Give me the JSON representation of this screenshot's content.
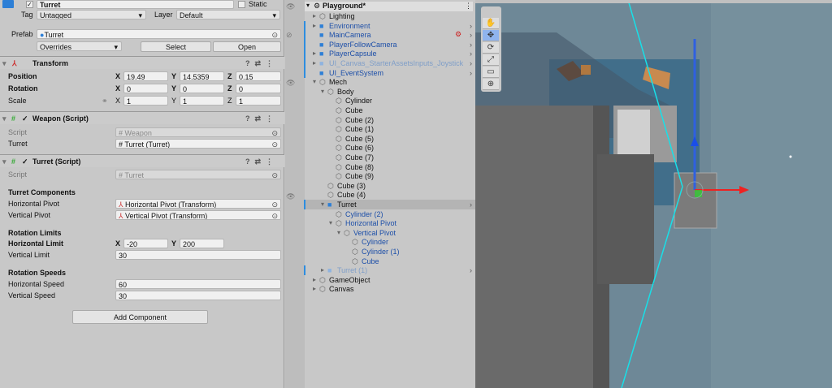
{
  "inspector": {
    "object_name": "Turret",
    "static_label": "Static",
    "tag_label": "Tag",
    "tag_value": "Untagged",
    "layer_label": "Layer",
    "layer_value": "Default",
    "prefab_label": "Prefab",
    "prefab_value": "Turret",
    "overrides": "Overrides",
    "select": "Select",
    "open": "Open",
    "transform": {
      "title": "Transform",
      "position_label": "Position",
      "rotation_label": "Rotation",
      "scale_label": "Scale",
      "position": {
        "x": "19.49",
        "y": "14.5359",
        "z": "0.15"
      },
      "rotation": {
        "x": "0",
        "y": "0",
        "z": "0"
      },
      "scale": {
        "x": "1",
        "y": "1",
        "z": "1"
      }
    },
    "weapon": {
      "title": "Weapon (Script)",
      "script_label": "Script",
      "script_value": "Weapon",
      "turret_label": "Turret",
      "turret_value": "Turret (Turret)"
    },
    "turret": {
      "title": "Turret (Script)",
      "script_label": "Script",
      "script_value": "Turret",
      "components_header": "Turret Components",
      "hpivot_label": "Horizontal Pivot",
      "hpivot_value": "Horizontal Pivot (Transform)",
      "vpivot_label": "Vertical Pivot",
      "vpivot_value": "Vertical Pivot (Transform)",
      "limits_header": "Rotation Limits",
      "hlimit_label": "Horizontal Limit",
      "hlimit_x": "-20",
      "hlimit_y": "200",
      "vlimit_label": "Vertical Limit",
      "vlimit_value": "30",
      "speeds_header": "Rotation Speeds",
      "hspeed_label": "Horizontal Speed",
      "hspeed_value": "60",
      "vspeed_label": "Vertical Speed",
      "vspeed_value": "30"
    },
    "add_component": "Add Component"
  },
  "hierarchy": {
    "scene": "Playground*",
    "items": [
      {
        "label": "Lighting",
        "depth": 0,
        "arrow": "right",
        "style": "normal",
        "prefab": false
      },
      {
        "label": "Environment",
        "depth": 0,
        "arrow": "right",
        "style": "blue",
        "prefab": true
      },
      {
        "label": "MainCamera",
        "depth": 0,
        "arrow": "",
        "style": "blue",
        "prefab": true
      },
      {
        "label": "PlayerFollowCamera",
        "depth": 0,
        "arrow": "",
        "style": "blue",
        "prefab": true
      },
      {
        "label": "PlayerCapsule",
        "depth": 0,
        "arrow": "right",
        "style": "blue",
        "prefab": true
      },
      {
        "label": "UI_Canvas_StarterAssetsInputs_Joystick",
        "depth": 0,
        "arrow": "right",
        "style": "faded",
        "prefab": true
      },
      {
        "label": "UI_EventSystem",
        "depth": 0,
        "arrow": "",
        "style": "blue",
        "prefab": true
      },
      {
        "label": "Mech",
        "depth": 0,
        "arrow": "down",
        "style": "normal",
        "prefab": false
      },
      {
        "label": "Body",
        "depth": 1,
        "arrow": "down",
        "style": "normal",
        "prefab": false
      },
      {
        "label": "Cylinder",
        "depth": 2,
        "arrow": "",
        "style": "normal",
        "prefab": false
      },
      {
        "label": "Cube",
        "depth": 2,
        "arrow": "",
        "style": "normal",
        "prefab": false
      },
      {
        "label": "Cube (2)",
        "depth": 2,
        "arrow": "",
        "style": "normal",
        "prefab": false
      },
      {
        "label": "Cube (1)",
        "depth": 2,
        "arrow": "",
        "style": "normal",
        "prefab": false
      },
      {
        "label": "Cube (5)",
        "depth": 2,
        "arrow": "",
        "style": "normal",
        "prefab": false
      },
      {
        "label": "Cube (6)",
        "depth": 2,
        "arrow": "",
        "style": "normal",
        "prefab": false
      },
      {
        "label": "Cube (7)",
        "depth": 2,
        "arrow": "",
        "style": "normal",
        "prefab": false
      },
      {
        "label": "Cube (8)",
        "depth": 2,
        "arrow": "",
        "style": "normal",
        "prefab": false
      },
      {
        "label": "Cube (9)",
        "depth": 2,
        "arrow": "",
        "style": "normal",
        "prefab": false
      },
      {
        "label": "Cube (3)",
        "depth": 1,
        "arrow": "",
        "style": "normal",
        "prefab": false
      },
      {
        "label": "Cube (4)",
        "depth": 1,
        "arrow": "",
        "style": "normal",
        "prefab": false
      },
      {
        "label": "Turret",
        "depth": 1,
        "arrow": "down",
        "style": "selected",
        "prefab": true
      },
      {
        "label": "Cylinder (2)",
        "depth": 2,
        "arrow": "",
        "style": "blue",
        "prefab": false
      },
      {
        "label": "Horizontal Pivot",
        "depth": 2,
        "arrow": "down",
        "style": "blue",
        "prefab": false
      },
      {
        "label": "Vertical Pivot",
        "depth": 3,
        "arrow": "down",
        "style": "blue",
        "prefab": false
      },
      {
        "label": "Cylinder",
        "depth": 4,
        "arrow": "",
        "style": "blue",
        "prefab": false
      },
      {
        "label": "Cylinder (1)",
        "depth": 4,
        "arrow": "",
        "style": "blue",
        "prefab": false
      },
      {
        "label": "Cube",
        "depth": 4,
        "arrow": "",
        "style": "blue",
        "prefab": false
      },
      {
        "label": "Turret (1)",
        "depth": 1,
        "arrow": "right",
        "style": "faded",
        "prefab": true
      },
      {
        "label": "GameObject",
        "depth": 0,
        "arrow": "right",
        "style": "normal",
        "prefab": false
      },
      {
        "label": "Canvas",
        "depth": 0,
        "arrow": "right",
        "style": "normal",
        "prefab": false
      }
    ]
  },
  "scene_tools": [
    "hand-icon",
    "move-icon",
    "rotate-icon",
    "scale-icon",
    "rect-icon",
    "transform-icon"
  ],
  "colors": {
    "accent": "#2d8de0",
    "prefab_blue": "#1d4fa8",
    "scene_bg": "#6b8594"
  }
}
